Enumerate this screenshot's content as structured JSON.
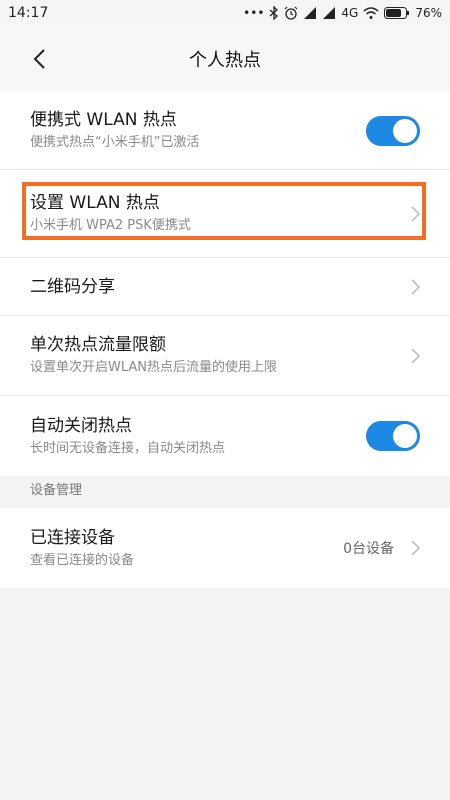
{
  "status": {
    "time": "14:17",
    "dots": "•••",
    "network": "4G",
    "battery": "76%"
  },
  "header": {
    "title": "个人热点",
    "back_icon": "chevron-left-icon"
  },
  "settings": [
    {
      "title": "便携式 WLAN 热点",
      "subtitle": "便携式热点“小米手机”已激活",
      "control": "toggle",
      "on": true
    },
    {
      "title": "设置 WLAN 热点",
      "subtitle": "小米手机 WPA2 PSK便携式",
      "control": "chevron",
      "highlighted": true
    },
    {
      "title": "二维码分享",
      "control": "chevron"
    },
    {
      "title": "单次热点流量限额",
      "subtitle": "设置单次开启WLAN热点后流量的使用上限",
      "control": "chevron"
    },
    {
      "title": "自动关闭热点",
      "subtitle": "长时间无设备连接，自动关闭热点",
      "control": "toggle",
      "on": true
    }
  ],
  "devices": {
    "section_label": "设备管理",
    "title": "已连接设备",
    "subtitle": "查看已连接的设备",
    "value": "0台设备"
  },
  "colors": {
    "toggle_on": "#1e88e5",
    "highlight_border": "#f26f21",
    "background": "#f3f3f3"
  }
}
